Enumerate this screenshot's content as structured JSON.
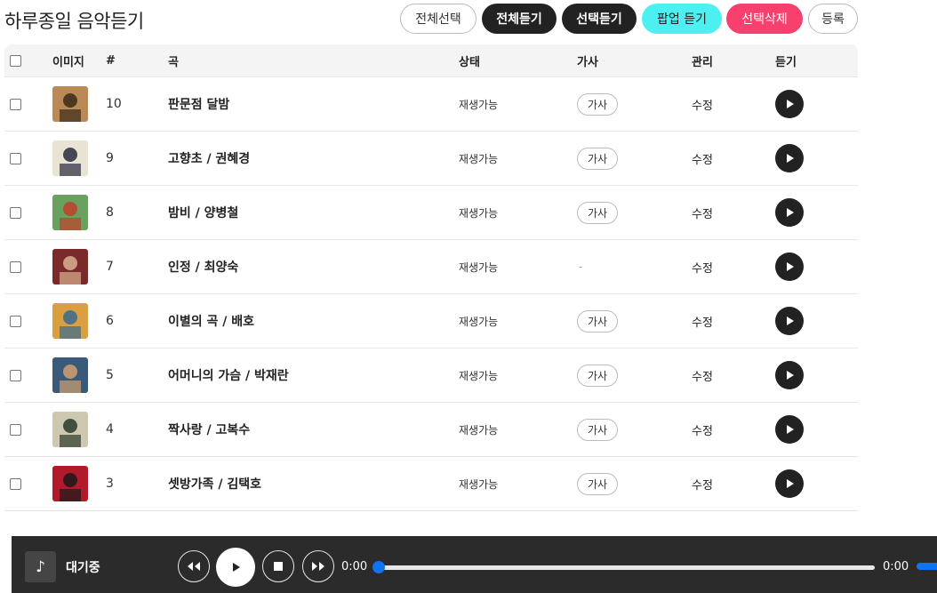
{
  "page": {
    "title": "하루종일 음악듣기"
  },
  "toolbar": {
    "select_all": "전체선택",
    "play_all": "전체듣기",
    "play_selected": "선택듣기",
    "popup_play": "팝업 듣기",
    "delete_selected": "선택삭제",
    "register": "등록"
  },
  "table": {
    "headers": {
      "image": "이미지",
      "num": "#",
      "song": "곡",
      "state": "상태",
      "lyrics": "가사",
      "manage": "관리",
      "listen": "듣기"
    },
    "rows": [
      {
        "num": "10",
        "song": "판문점 달밤",
        "state": "재생가능",
        "lyrics": "가사",
        "manage": "수정"
      },
      {
        "num": "9",
        "song": "고향초 / 권혜경",
        "state": "재생가능",
        "lyrics": "가사",
        "manage": "수정"
      },
      {
        "num": "8",
        "song": "밤비 / 양병철",
        "state": "재생가능",
        "lyrics": "가사",
        "manage": "수정"
      },
      {
        "num": "7",
        "song": "인정 / 최양숙",
        "state": "재생가능",
        "lyrics": "-",
        "manage": "수정"
      },
      {
        "num": "6",
        "song": "이별의 곡 / 배호",
        "state": "재생가능",
        "lyrics": "가사",
        "manage": "수정"
      },
      {
        "num": "5",
        "song": "어머니의 가슴 / 박재란",
        "state": "재생가능",
        "lyrics": "가사",
        "manage": "수정"
      },
      {
        "num": "4",
        "song": "짝사랑 / 고복수",
        "state": "재생가능",
        "lyrics": "가사",
        "manage": "수정"
      },
      {
        "num": "3",
        "song": "셋방가족 / 김택호",
        "state": "재생가능",
        "lyrics": "가사",
        "manage": "수정"
      }
    ]
  },
  "player": {
    "note_icon": "♪",
    "status": "대기중",
    "current_time": "0:00",
    "total_time": "0:00",
    "progress": 0
  },
  "colors": {
    "dark_button": "#222222",
    "popup_button": "#4df0f0",
    "delete_button": "#f7406e",
    "player_bg": "#2b2b2b",
    "progress_accent": "#1273f0"
  }
}
